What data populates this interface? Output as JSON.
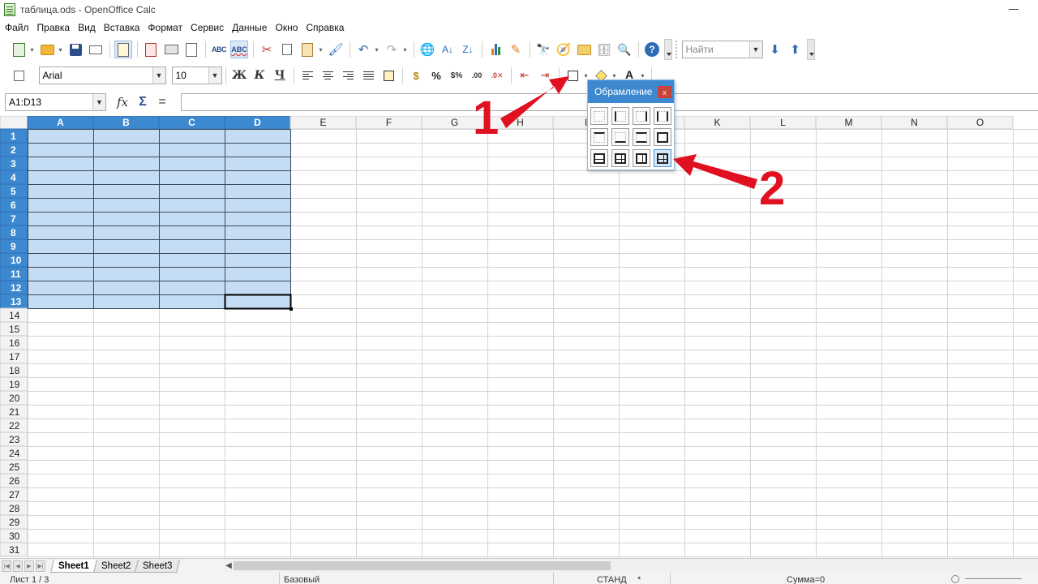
{
  "window": {
    "title": "таблица.ods - OpenOffice Calc"
  },
  "menu": [
    "Файл",
    "Правка",
    "Вид",
    "Вставка",
    "Формат",
    "Сервис",
    "Данные",
    "Окно",
    "Справка"
  ],
  "toolbar": {
    "find_placeholder": "Найти",
    "font_name": "Arial",
    "font_size": "10"
  },
  "formula_bar": {
    "name_box": "A1:D13",
    "fx_icon": "function-wizard-icon",
    "sum_icon": "sum-icon",
    "equals_icon": "equals-icon",
    "formula": ""
  },
  "grid": {
    "columns": [
      "A",
      "B",
      "C",
      "D",
      "E",
      "F",
      "G",
      "H",
      "I",
      "J",
      "K",
      "L",
      "M",
      "N",
      "O"
    ],
    "rows": [
      "1",
      "2",
      "3",
      "4",
      "5",
      "6",
      "7",
      "8",
      "9",
      "10",
      "11",
      "12",
      "13",
      "14",
      "15",
      "16",
      "17",
      "18",
      "19",
      "20",
      "21",
      "22",
      "23",
      "24",
      "25",
      "26",
      "27",
      "28",
      "29",
      "30",
      "31"
    ],
    "selection": {
      "range": "A1:D13",
      "columns": 4,
      "rows": 13
    },
    "active_cell": "D13",
    "colors": {
      "selection": "#c5ddf4",
      "header_selected": "#3d89d0",
      "gridline": "#d4d4d4"
    }
  },
  "sheets": {
    "tabs": [
      "Sheet1",
      "Sheet2",
      "Sheet3"
    ],
    "active": "Sheet1"
  },
  "status": {
    "sheet_pos": "Лист 1 / 3",
    "style": "Базовый",
    "mode": "СТАНД",
    "modified": "*",
    "sum": "Сумма=0"
  },
  "border_popup": {
    "title": "Обрамление",
    "close_label": "x",
    "options": [
      "no-border",
      "left-border",
      "right-border",
      "left-right-border",
      "top-border",
      "bottom-border",
      "top-bottom-border",
      "outer-border",
      "outer-horizontal-border",
      "outer-all-inner-border",
      "outer-vertical-border",
      "all-borders"
    ],
    "selected_index": 11
  },
  "annotations": {
    "step1": "1",
    "step2": "2",
    "color": "#e01020"
  }
}
